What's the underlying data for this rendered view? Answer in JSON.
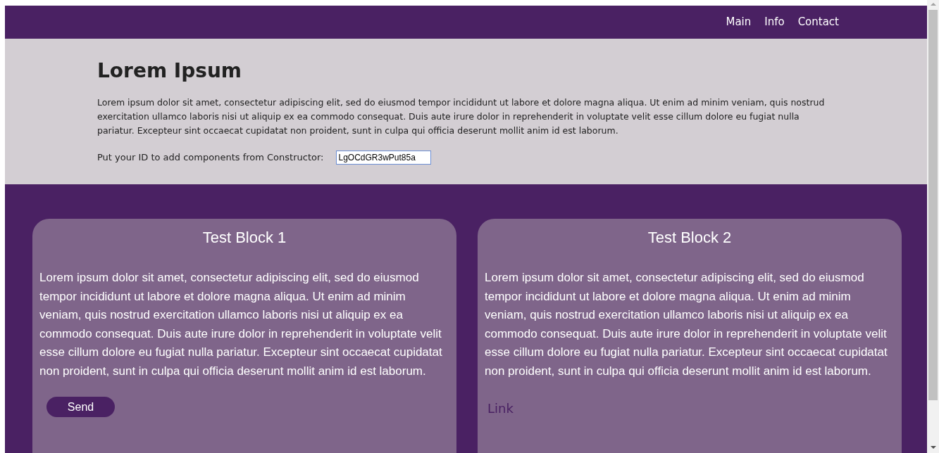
{
  "nav": {
    "links": [
      "Main",
      "Info",
      "Contact"
    ]
  },
  "header": {
    "title": "Lorem Ipsum",
    "text": "Lorem ipsum dolor sit amet, consectetur adipiscing elit, sed do eiusmod tempor incididunt ut labore et dolore magna aliqua. Ut enim ad minim veniam, quis nostrud exercitation ullamco laboris nisi ut aliquip ex ea commodo consequat. Duis aute irure dolor in reprehenderit in voluptate velit esse cillum dolore eu fugiat nulla pariatur. Excepteur sint occaecat cupidatat non proident, sunt in culpa qui officia deserunt mollit anim id est laborum.",
    "id_label": "Put your ID to add components from Constructor:",
    "id_value": "LgOCdGR3wPut85a"
  },
  "blocks": [
    {
      "title": "Test Block 1",
      "text": "Lorem ipsum dolor sit amet, consectetur adipiscing elit, sed do eiusmod tempor incididunt ut labore et dolore magna aliqua. Ut enim ad minim veniam, quis nostrud exercitation ullamco laboris nisi ut aliquip ex ea commodo consequat. Duis aute irure dolor in reprehenderit in voluptate velit esse cillum dolore eu fugiat nulla pariatur. Excepteur sint occaecat cupidatat non proident, sunt in culpa qui officia deserunt mollit anim id est laborum.",
      "action": {
        "kind": "button",
        "label": "Send"
      }
    },
    {
      "title": "Test Block 2",
      "text": "Lorem ipsum dolor sit amet, consectetur adipiscing elit, sed do eiusmod tempor incididunt ut labore et dolore magna aliqua. Ut enim ad minim veniam, quis nostrud exercitation ullamco laboris nisi ut aliquip ex ea commodo consequat. Duis aute irure dolor in reprehenderit in voluptate velit esse cillum dolore eu fugiat nulla pariatur. Excepteur sint occaecat cupidatat non proident, sunt in culpa qui officia deserunt mollit anim id est laborum.",
      "action": {
        "kind": "link",
        "label": "Link"
      }
    }
  ]
}
